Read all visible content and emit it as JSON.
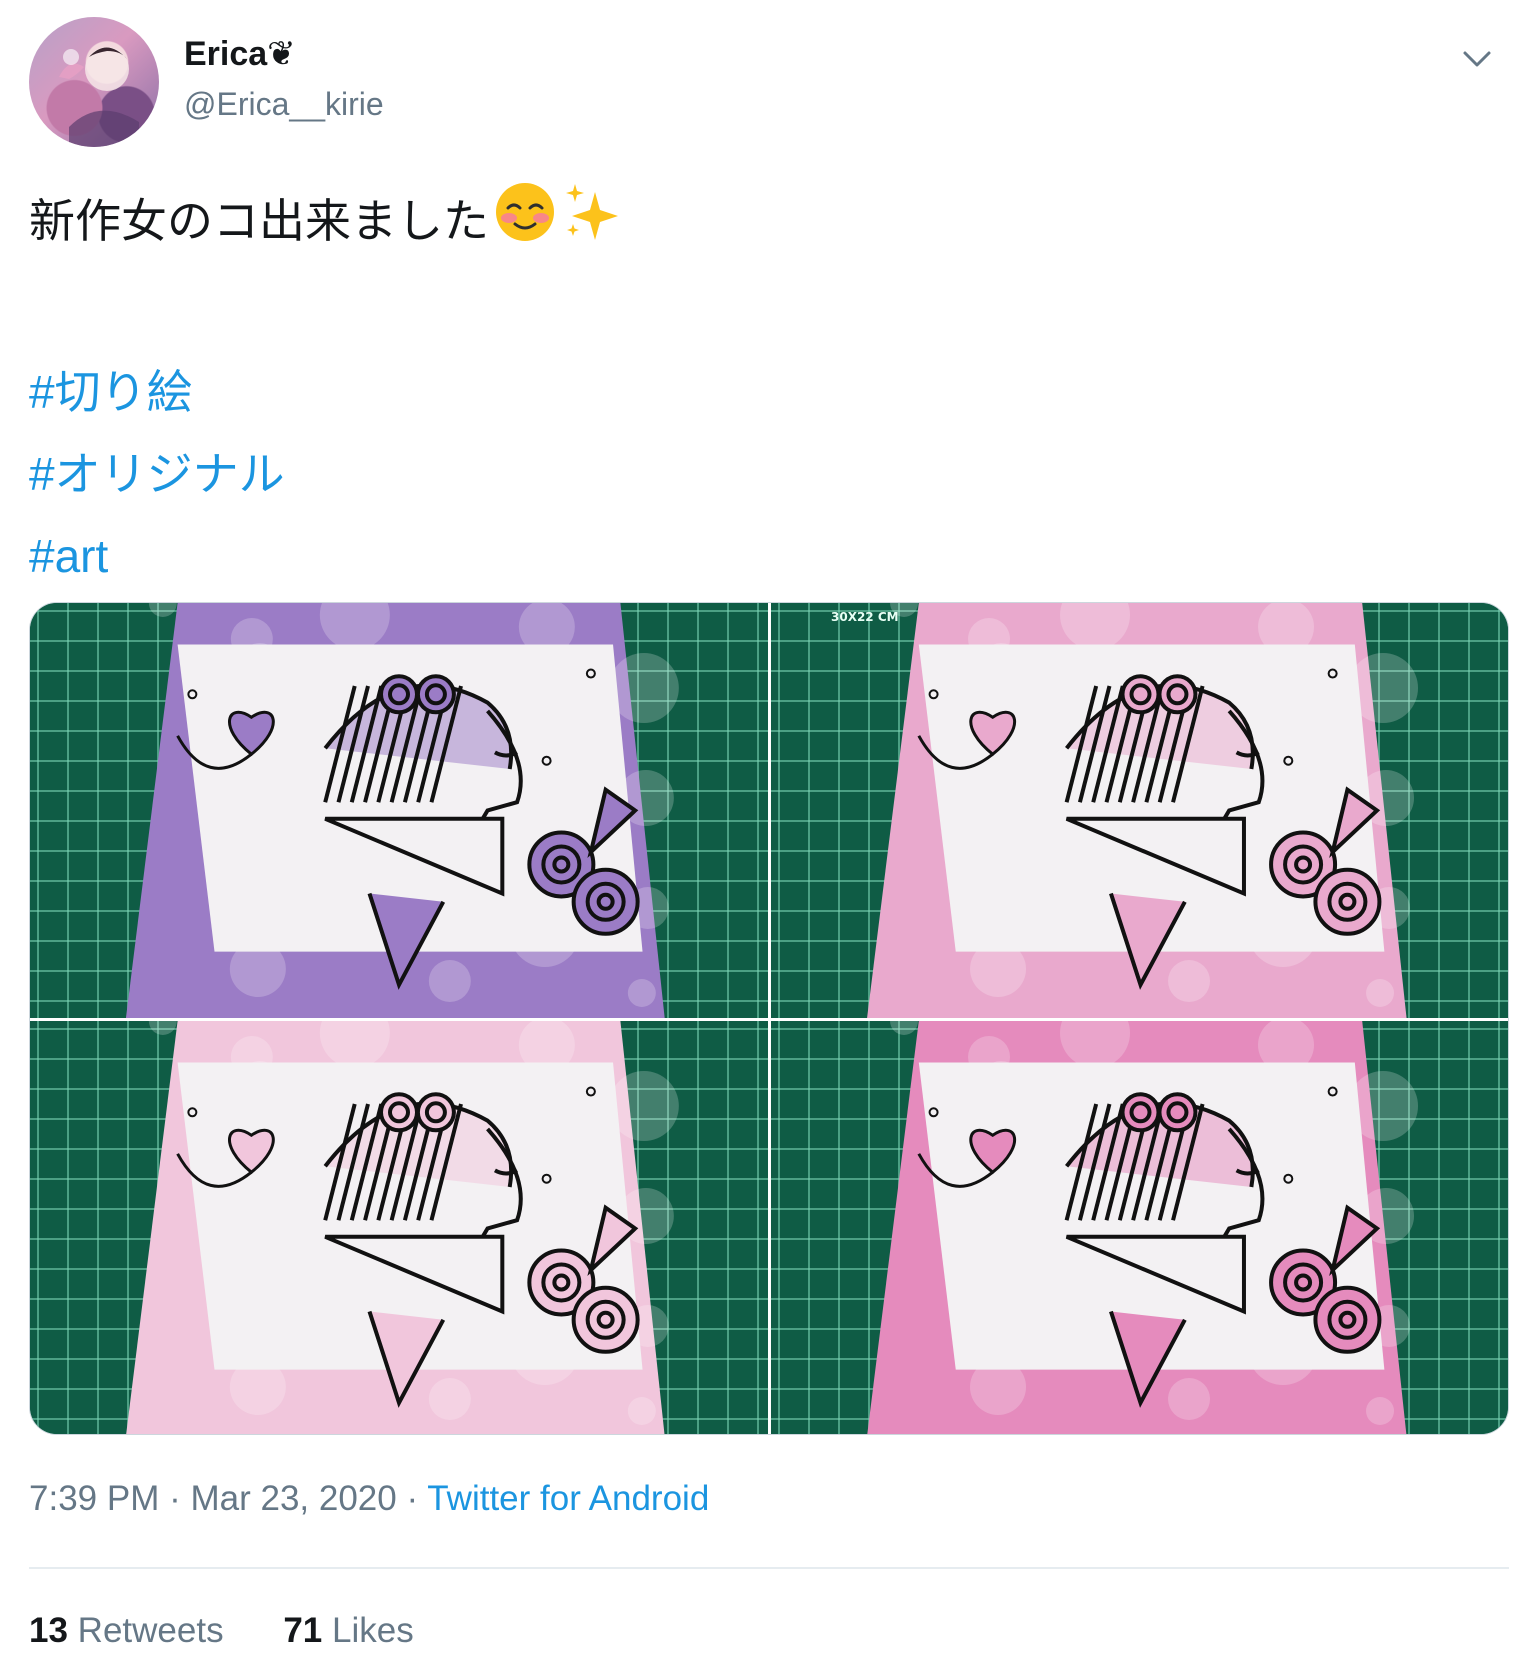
{
  "tweet": {
    "author": {
      "display_name": "Erica❦",
      "handle": "@Erica__kirie",
      "avatar": "avatar-image"
    },
    "more_icon": "chevron-down-icon",
    "text_line1": "新作女のコ出来ました",
    "emojis": [
      "smiling-face-with-blush-emoji",
      "sparkles-emoji"
    ],
    "hashtags": [
      "#切り絵",
      "#オリジナル",
      "#art"
    ],
    "media": {
      "count": 4,
      "photos": [
        {
          "name": "photo-purple-background",
          "tint": "#9b7cc6"
        },
        {
          "name": "photo-pink-blossom-background",
          "tint": "#e9a9cd",
          "mat_label": "30X22 CM"
        },
        {
          "name": "photo-pink-bunnies-background",
          "tint": "#f1c6dc"
        },
        {
          "name": "photo-magenta-blossom-background",
          "tint": "#e58bbd"
        }
      ]
    },
    "time": "7:39 PM",
    "separator": "·",
    "date": "Mar 23, 2020",
    "source": "Twitter for Android",
    "retweets_count": "13",
    "retweets_label": "Retweets",
    "likes_count": "71",
    "likes_label": "Likes"
  },
  "colors": {
    "text": "#14171a",
    "secondary": "#657786",
    "link": "#1b95e0",
    "divider": "#e6ecf0",
    "cutting_mat": "#0f5c45"
  }
}
